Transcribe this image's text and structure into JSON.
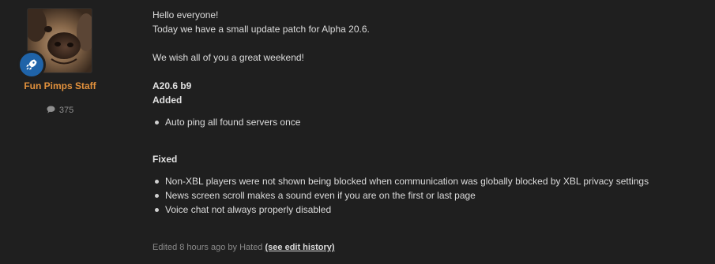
{
  "author": {
    "name": "Fun Pimps Staff",
    "post_count": "375",
    "avatar_icon": "dog-avatar",
    "badge_icon": "rocket-icon",
    "name_color": "#e2913c",
    "badge_color": "#1f63a8"
  },
  "post": {
    "greeting": "Hello everyone!",
    "intro": "Today we have a small update patch for Alpha 20.6.",
    "weekend": "We wish all of you a great weekend!",
    "version": "A20.6 b9",
    "added_heading": "Added",
    "added_items": [
      "Auto ping all found servers once"
    ],
    "fixed_heading": "Fixed",
    "fixed_items": [
      "Non-XBL players were not shown being blocked when communication was globally blocked by XBL privacy settings",
      "News screen scroll makes a sound even if you are on the first or last page",
      "Voice chat not always properly disabled"
    ],
    "edited_text": "Edited 8 hours ago by Hated",
    "edit_history_link": "(see edit history)"
  }
}
